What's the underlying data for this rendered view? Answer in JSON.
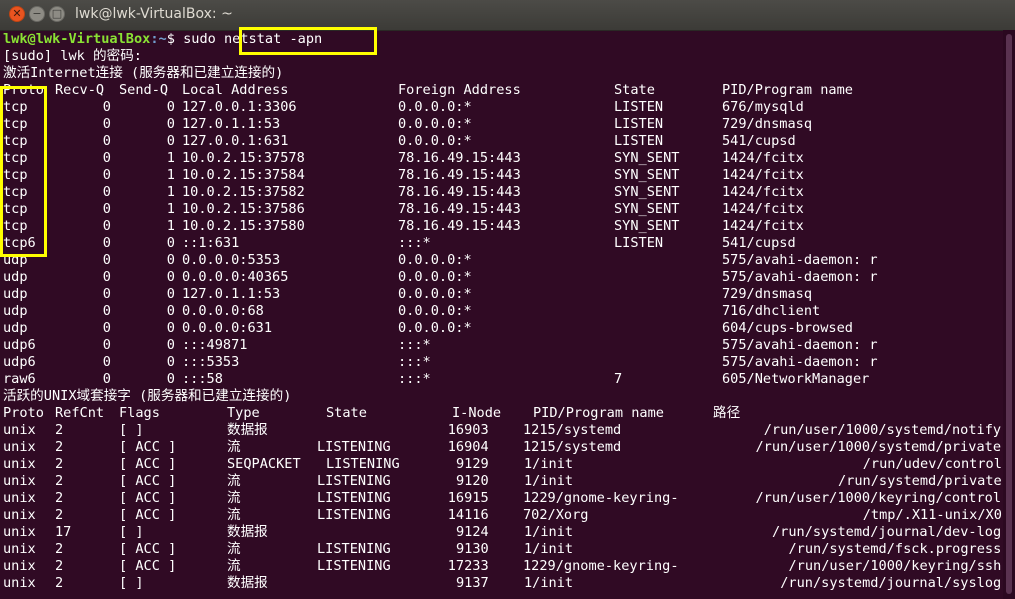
{
  "window": {
    "title": "lwk@lwk-VirtualBox: ~"
  },
  "prompt": {
    "user_host": "lwk@lwk-VirtualBox",
    "path": ":~",
    "dollar": "$ sudo ",
    "command": "netstat -apn"
  },
  "sudo_prompt": "[sudo] lwk 的密码:",
  "inet_header": "激活Internet连接 (服务器和已建立连接的)",
  "inet_columns": [
    "Proto",
    "Recv-Q",
    "Send-Q",
    "Local Address",
    "Foreign Address",
    "State",
    "PID/Program name"
  ],
  "inet_rows": [
    [
      "tcp",
      "0",
      "0",
      "127.0.0.1:3306",
      "0.0.0.0:*",
      "LISTEN",
      "676/mysqld"
    ],
    [
      "tcp",
      "0",
      "0",
      "127.0.1.1:53",
      "0.0.0.0:*",
      "LISTEN",
      "729/dnsmasq"
    ],
    [
      "tcp",
      "0",
      "0",
      "127.0.0.1:631",
      "0.0.0.0:*",
      "LISTEN",
      "541/cupsd"
    ],
    [
      "tcp",
      "0",
      "1",
      "10.0.2.15:37578",
      "78.16.49.15:443",
      "SYN_SENT",
      "1424/fcitx"
    ],
    [
      "tcp",
      "0",
      "1",
      "10.0.2.15:37584",
      "78.16.49.15:443",
      "SYN_SENT",
      "1424/fcitx"
    ],
    [
      "tcp",
      "0",
      "1",
      "10.0.2.15:37582",
      "78.16.49.15:443",
      "SYN_SENT",
      "1424/fcitx"
    ],
    [
      "tcp",
      "0",
      "1",
      "10.0.2.15:37586",
      "78.16.49.15:443",
      "SYN_SENT",
      "1424/fcitx"
    ],
    [
      "tcp",
      "0",
      "1",
      "10.0.2.15:37580",
      "78.16.49.15:443",
      "SYN_SENT",
      "1424/fcitx"
    ],
    [
      "tcp6",
      "0",
      "0",
      "::1:631",
      ":::*",
      "LISTEN",
      "541/cupsd"
    ],
    [
      "udp",
      "0",
      "0",
      "0.0.0.0:5353",
      "0.0.0.0:*",
      "",
      "575/avahi-daemon: r"
    ],
    [
      "udp",
      "0",
      "0",
      "0.0.0.0:40365",
      "0.0.0.0:*",
      "",
      "575/avahi-daemon: r"
    ],
    [
      "udp",
      "0",
      "0",
      "127.0.1.1:53",
      "0.0.0.0:*",
      "",
      "729/dnsmasq"
    ],
    [
      "udp",
      "0",
      "0",
      "0.0.0.0:68",
      "0.0.0.0:*",
      "",
      "716/dhclient"
    ],
    [
      "udp",
      "0",
      "0",
      "0.0.0.0:631",
      "0.0.0.0:*",
      "",
      "604/cups-browsed"
    ],
    [
      "udp6",
      "0",
      "0",
      ":::49871",
      ":::*",
      "",
      "575/avahi-daemon: r"
    ],
    [
      "udp6",
      "0",
      "0",
      ":::5353",
      ":::*",
      "",
      "575/avahi-daemon: r"
    ],
    [
      "raw6",
      "0",
      "0",
      ":::58",
      ":::*",
      "7",
      "605/NetworkManager"
    ]
  ],
  "unix_header": "活跃的UNIX域套接字 (服务器和已建立连接的)",
  "unix_columns": [
    "Proto",
    "RefCnt",
    "Flags",
    "Type",
    "State",
    "I-Node",
    "PID/Program name",
    "路径"
  ],
  "unix_rows": [
    [
      "unix",
      "2",
      "[ ]",
      "数据报",
      "",
      "16903",
      "1215/systemd",
      "/run/user/1000/systemd/notify"
    ],
    [
      "unix",
      "2",
      "[ ACC ]",
      "流",
      "LISTENING",
      "16904",
      "1215/systemd",
      "/run/user/1000/systemd/private"
    ],
    [
      "unix",
      "2",
      "[ ACC ]",
      "SEQPACKET",
      "LISTENING",
      "9129",
      "1/init",
      "/run/udev/control"
    ],
    [
      "unix",
      "2",
      "[ ACC ]",
      "流",
      "LISTENING",
      "9120",
      "1/init",
      "/run/systemd/private"
    ],
    [
      "unix",
      "2",
      "[ ACC ]",
      "流",
      "LISTENING",
      "16915",
      "1229/gnome-keyring-",
      "/run/user/1000/keyring/control"
    ],
    [
      "unix",
      "2",
      "[ ACC ]",
      "流",
      "LISTENING",
      "14116",
      "702/Xorg",
      "/tmp/.X11-unix/X0"
    ],
    [
      "unix",
      "17",
      "[ ]",
      "数据报",
      "",
      "9124",
      "1/init",
      "/run/systemd/journal/dev-log"
    ],
    [
      "unix",
      "2",
      "[ ACC ]",
      "流",
      "LISTENING",
      "9130",
      "1/init",
      "/run/systemd/fsck.progress"
    ],
    [
      "unix",
      "2",
      "[ ACC ]",
      "流",
      "LISTENING",
      "17233",
      "1229/gnome-keyring-",
      "/run/user/1000/keyring/ssh"
    ],
    [
      "unix",
      "2",
      "[ ]",
      "数据报",
      "",
      "9137",
      "1/init",
      "/run/systemd/journal/syslog"
    ]
  ],
  "colors": {
    "background": "#300a24",
    "text": "#ffffff",
    "user_host": "#8ae234",
    "path": "#729fcf",
    "highlight": "#ffff00"
  }
}
